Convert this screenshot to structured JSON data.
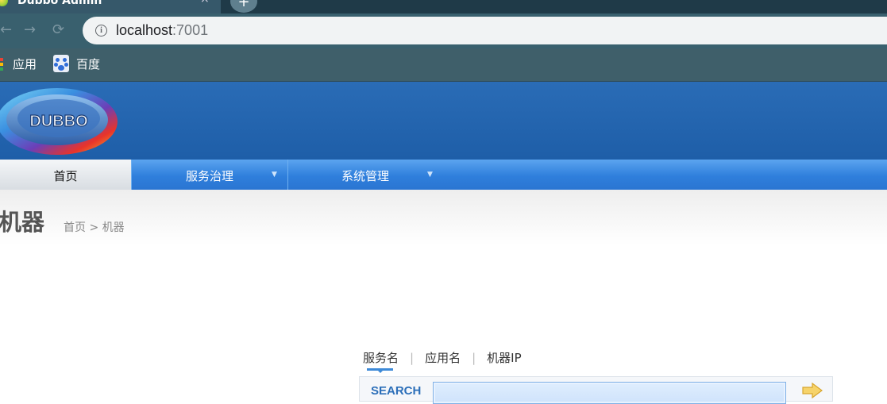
{
  "browser": {
    "tab_title": "Dubbo Admin",
    "tab_close": "×",
    "new_tab": "+",
    "back": "←",
    "forward": "→",
    "reload": "⟳",
    "info": "i",
    "url_host": "localhost",
    "url_port": ":7001",
    "bookmarks": [
      {
        "label": "应用",
        "icon": "apps-icon"
      },
      {
        "label": "百度",
        "icon": "baidu-icon"
      }
    ]
  },
  "app": {
    "logo_text": "DUBBO",
    "menu": {
      "home": "首页",
      "service_governance": "服务治理",
      "system_management": "系统管理",
      "caret": "▼"
    },
    "page": {
      "title": "机器",
      "breadcrumb": "首页 > 机器"
    },
    "search": {
      "tabs": [
        "服务名",
        "应用名",
        "机器IP"
      ],
      "separator": "|",
      "active_tab": "服务名",
      "label": "SEARCH",
      "value": ""
    }
  },
  "colors": {
    "banner": "#2366b2",
    "menu_bar": "#2f7fdc",
    "search_label": "#2c6fb9"
  }
}
